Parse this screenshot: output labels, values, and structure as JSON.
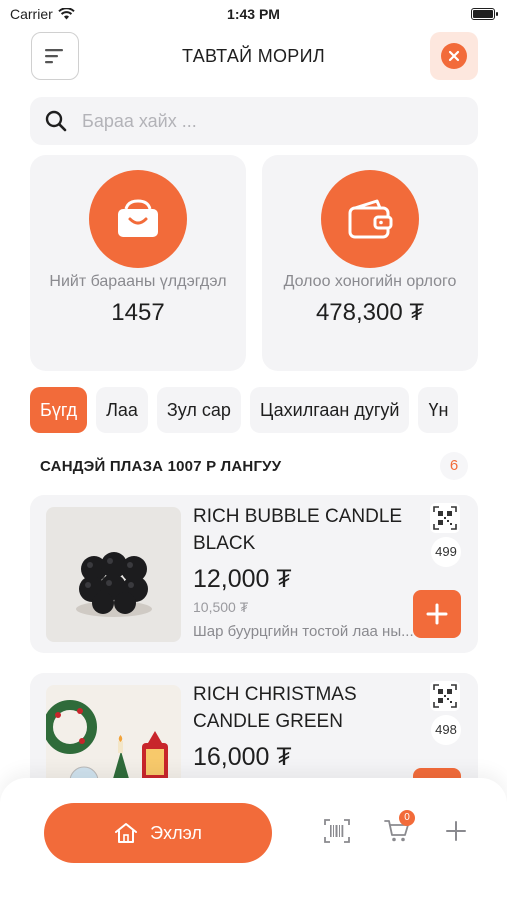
{
  "status_bar": {
    "carrier": "Carrier",
    "time": "1:43 PM"
  },
  "header": {
    "title": "ТАВТАЙ МОРИЛ"
  },
  "search": {
    "placeholder": "Бараа хайх ..."
  },
  "stats": [
    {
      "label": "Нийт барааны үлдэгдэл",
      "value": "1457",
      "icon": "shopping-bag-icon"
    },
    {
      "label": "Долоо хоногийн орлого",
      "value": "478,300 ₮",
      "icon": "wallet-icon"
    }
  ],
  "categories": [
    "Бүгд",
    "Лаа",
    "Зул сар",
    "Цахилгаан дугуй",
    "Үн"
  ],
  "section": {
    "title": "САНДЭЙ ПЛАЗА 1007 Р ЛАНГУУ",
    "count": "6"
  },
  "products": [
    {
      "name": "RICH BUBBLE CANDLE BLACK",
      "price": "12,000 ₮",
      "old_price": "10,500 ₮",
      "description": "Шар буурцгийн тостой лаа ны...",
      "stock": "499"
    },
    {
      "name": "RICH CHRISTMAS CANDLE GREEN",
      "price": "16,000 ₮",
      "old_price": "",
      "description": "",
      "stock": "498"
    }
  ],
  "bottom_nav": {
    "home_label": "Эхлэл",
    "cart_count": "0"
  },
  "colors": {
    "accent": "#f26b3a",
    "card_bg": "#f4f4f6",
    "muted_text": "#8a8a8f"
  }
}
